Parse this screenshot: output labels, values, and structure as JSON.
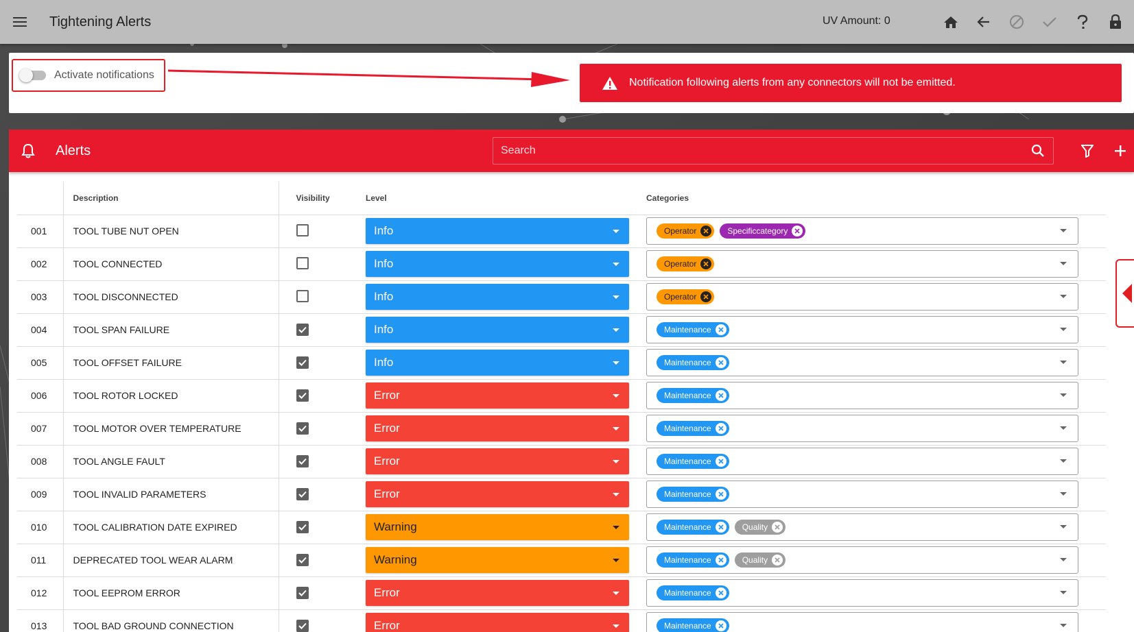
{
  "topbar": {
    "title": "Tightening Alerts",
    "uv_amount": "UV Amount: 0",
    "icons": [
      "menu-icon",
      "home-icon",
      "back-arrow-icon",
      "cancel-icon",
      "check-icon",
      "help-icon",
      "lock-icon"
    ]
  },
  "notification": {
    "toggle_label": "Activate notifications",
    "toggle_on": false,
    "banner_text": "Notification following alerts from any connectors will not be emitted.",
    "banner_color": "#e8192c"
  },
  "alerts": {
    "title": "Alerts",
    "search_placeholder": "Search",
    "header_color": "#e8192c",
    "columns": {
      "num": "",
      "description": "Description",
      "visibility": "Visibility",
      "level": "Level",
      "categories": "Categories"
    },
    "rows": [
      {
        "num": "001",
        "desc": "TOOL TUBE NUT OPEN",
        "visible": false,
        "level": "Info",
        "cats": [
          "Operator",
          "Specificcategory"
        ]
      },
      {
        "num": "002",
        "desc": "TOOL CONNECTED",
        "visible": false,
        "level": "Info",
        "cats": [
          "Operator"
        ]
      },
      {
        "num": "003",
        "desc": "TOOL DISCONNECTED",
        "visible": false,
        "level": "Info",
        "cats": [
          "Operator"
        ]
      },
      {
        "num": "004",
        "desc": "TOOL SPAN FAILURE",
        "visible": true,
        "level": "Info",
        "cats": [
          "Maintenance"
        ]
      },
      {
        "num": "005",
        "desc": "TOOL OFFSET FAILURE",
        "visible": true,
        "level": "Info",
        "cats": [
          "Maintenance"
        ]
      },
      {
        "num": "006",
        "desc": "TOOL ROTOR LOCKED",
        "visible": true,
        "level": "Error",
        "cats": [
          "Maintenance"
        ]
      },
      {
        "num": "007",
        "desc": "TOOL MOTOR OVER TEMPERATURE",
        "visible": true,
        "level": "Error",
        "cats": [
          "Maintenance"
        ]
      },
      {
        "num": "008",
        "desc": "TOOL ANGLE FAULT",
        "visible": true,
        "level": "Error",
        "cats": [
          "Maintenance"
        ]
      },
      {
        "num": "009",
        "desc": "TOOL INVALID PARAMETERS",
        "visible": true,
        "level": "Error",
        "cats": [
          "Maintenance"
        ]
      },
      {
        "num": "010",
        "desc": "TOOL CALIBRATION DATE EXPIRED",
        "visible": true,
        "level": "Warning",
        "cats": [
          "Maintenance",
          "Quality"
        ]
      },
      {
        "num": "011",
        "desc": "DEPRECATED TOOL WEAR ALARM",
        "visible": true,
        "level": "Warning",
        "cats": [
          "Maintenance",
          "Quality"
        ]
      },
      {
        "num": "012",
        "desc": "TOOL EEPROM ERROR",
        "visible": true,
        "level": "Error",
        "cats": [
          "Maintenance"
        ]
      },
      {
        "num": "013",
        "desc": "TOOL BAD GROUND CONNECTION",
        "visible": true,
        "level": "Error",
        "cats": [
          "Maintenance"
        ]
      }
    ]
  },
  "colors": {
    "info": "#2196f3",
    "error": "#f44336",
    "warning": "#ff9800",
    "operator_chip": "#ff9800",
    "specific_chip": "#9c27b0",
    "maintenance_chip": "#2196f3",
    "quality_chip": "#9e9e9e"
  }
}
